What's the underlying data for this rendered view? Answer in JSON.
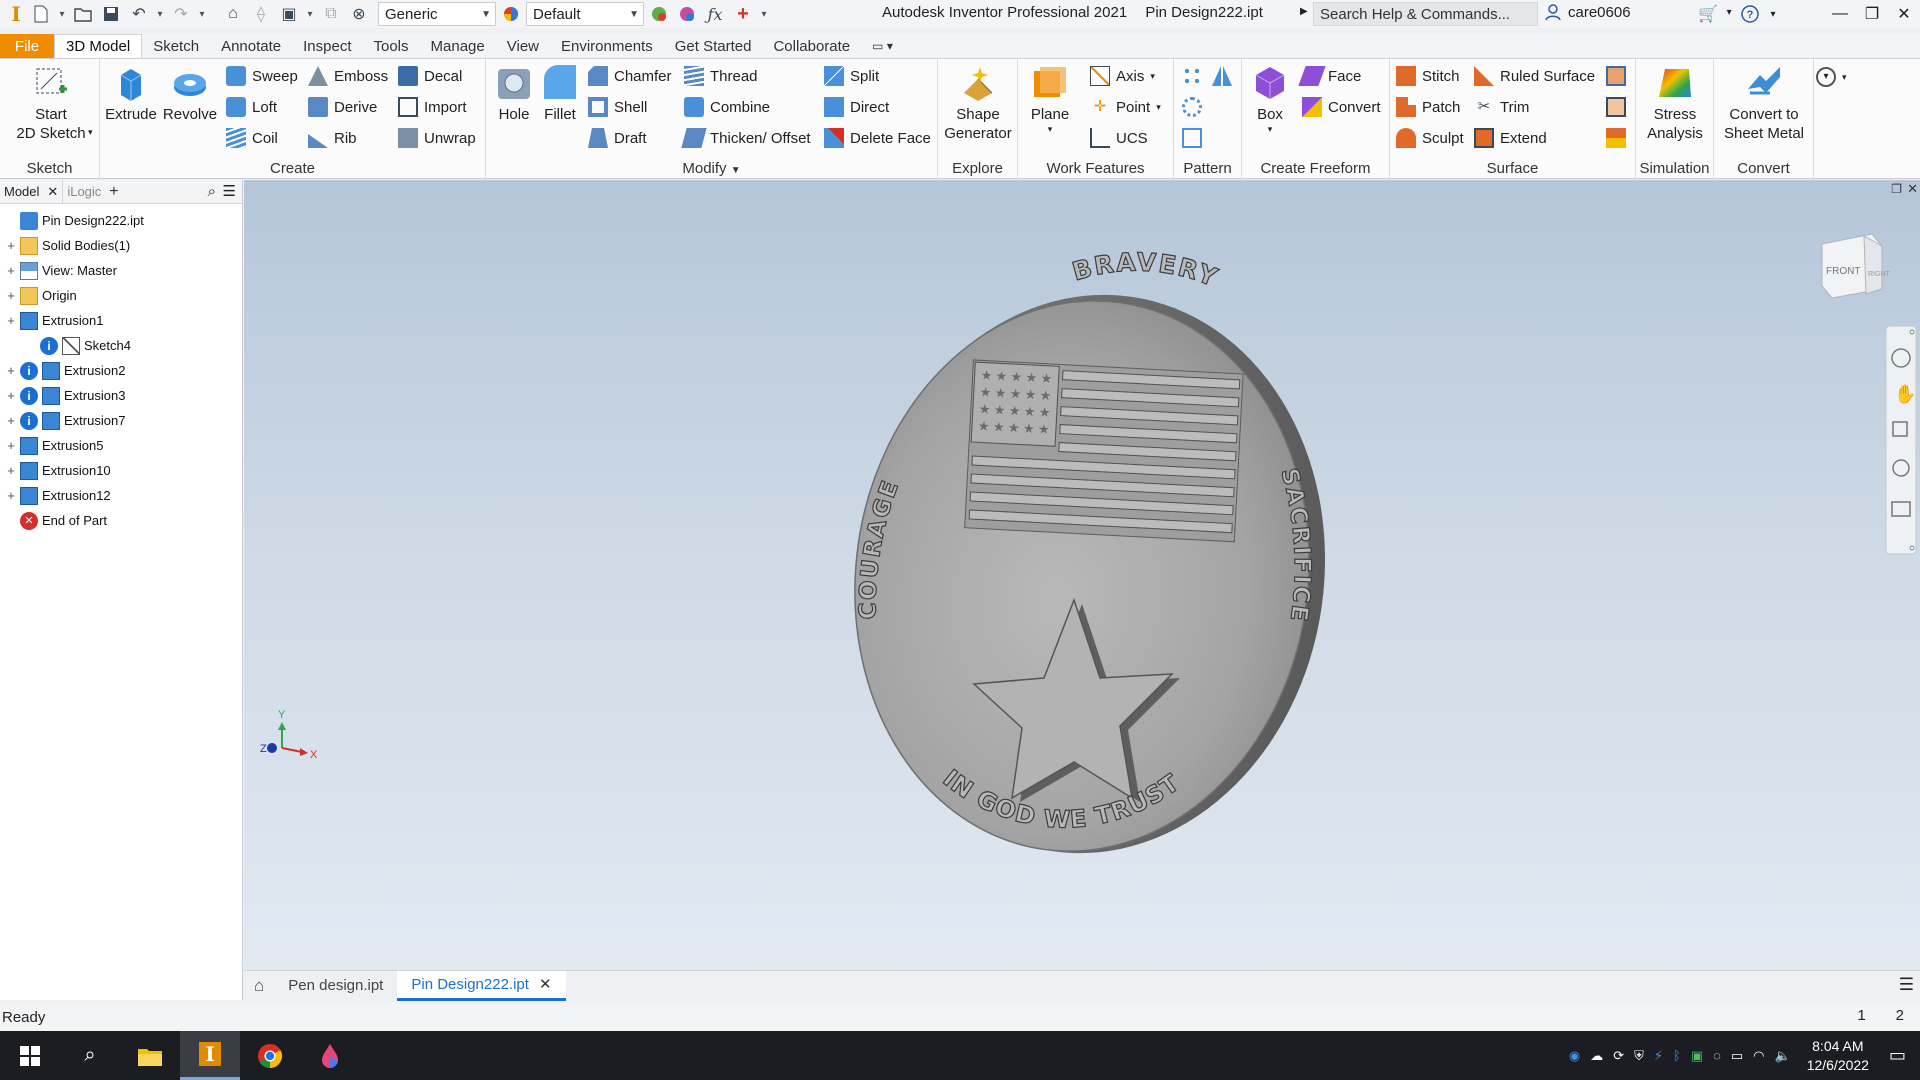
{
  "window": {
    "app_name": "Autodesk Inventor Professional 2021",
    "document": "Pin Design222.ipt",
    "search_placeholder": "Search Help & Commands...",
    "user": "care0606",
    "material_combo": "Generic",
    "appearance_combo": "Default"
  },
  "ribbon_tabs": [
    {
      "label": "File"
    },
    {
      "label": "3D Model"
    },
    {
      "label": "Sketch"
    },
    {
      "label": "Annotate"
    },
    {
      "label": "Inspect"
    },
    {
      "label": "Tools"
    },
    {
      "label": "Manage"
    },
    {
      "label": "View"
    },
    {
      "label": "Environments"
    },
    {
      "label": "Get Started"
    },
    {
      "label": "Collaborate"
    }
  ],
  "ribbon": {
    "sketch_panel": {
      "label": "Sketch",
      "start_sketch": "Start\n2D Sketch"
    },
    "create_panel": {
      "label": "Create",
      "extrude": "Extrude",
      "revolve": "Revolve",
      "sweep": "Sweep",
      "loft": "Loft",
      "coil": "Coil",
      "emboss": "Emboss",
      "derive": "Derive",
      "rib": "Rib",
      "decal": "Decal",
      "import": "Import",
      "unwrap": "Unwrap"
    },
    "modify_panel": {
      "label": "Modify",
      "hole": "Hole",
      "fillet": "Fillet",
      "chamfer": "Chamfer",
      "shell": "Shell",
      "draft": "Draft",
      "thread": "Thread",
      "combine": "Combine",
      "thicken": "Thicken/ Offset",
      "split": "Split",
      "direct": "Direct",
      "delete_face": "Delete Face"
    },
    "explore_panel": {
      "label": "Explore",
      "shape_generator": "Shape\nGenerator"
    },
    "work_features_panel": {
      "label": "Work Features",
      "plane": "Plane",
      "axis": "Axis",
      "point": "Point",
      "ucs": "UCS"
    },
    "pattern_panel": {
      "label": "Pattern"
    },
    "freeform_panel": {
      "label": "Create Freeform",
      "box": "Box",
      "face": "Face",
      "convert": "Convert"
    },
    "surface_panel": {
      "label": "Surface",
      "stitch": "Stitch",
      "patch": "Patch",
      "sculpt": "Sculpt",
      "ruled_surface": "Ruled Surface",
      "trim": "Trim",
      "extend": "Extend"
    },
    "simulation_panel": {
      "label": "Simulation",
      "stress_analysis": "Stress\nAnalysis"
    },
    "convert_panel": {
      "label": "Convert",
      "convert_sheet_metal": "Convert to\nSheet Metal"
    }
  },
  "browser": {
    "tabs": [
      {
        "label": "Model"
      },
      {
        "label": "iLogic"
      }
    ],
    "tree": [
      {
        "label": "Pin Design222.ipt",
        "icon": "part-icon",
        "expand": "",
        "info": false,
        "indent": 0
      },
      {
        "label": "Solid Bodies(1)",
        "icon": "folder-icon",
        "expand": "+",
        "info": false,
        "indent": 0
      },
      {
        "label": "View: Master",
        "icon": "view-icon",
        "expand": "+",
        "info": false,
        "indent": 0
      },
      {
        "label": "Origin",
        "icon": "folder-icon",
        "expand": "+",
        "info": false,
        "indent": 0
      },
      {
        "label": "Extrusion1",
        "icon": "extrusion-icon",
        "expand": "+",
        "info": false,
        "indent": 0
      },
      {
        "label": "Sketch4",
        "icon": "sketch-icon",
        "expand": "",
        "info": true,
        "indent": 1
      },
      {
        "label": "Extrusion2",
        "icon": "extrusion-icon",
        "expand": "+",
        "info": true,
        "indent": 0
      },
      {
        "label": "Extrusion3",
        "icon": "extrusion-icon",
        "expand": "+",
        "info": true,
        "indent": 0
      },
      {
        "label": "Extrusion7",
        "icon": "extrusion-icon",
        "expand": "+",
        "info": true,
        "indent": 0
      },
      {
        "label": "Extrusion5",
        "icon": "extrusion-icon",
        "expand": "+",
        "info": false,
        "indent": 0
      },
      {
        "label": "Extrusion10",
        "icon": "extrusion-icon",
        "expand": "+",
        "info": false,
        "indent": 0
      },
      {
        "label": "Extrusion12",
        "icon": "extrusion-icon",
        "expand": "+",
        "info": false,
        "indent": 0
      },
      {
        "label": "End of Part",
        "icon": "end-of-part-icon",
        "expand": "",
        "info": false,
        "indent": 0
      }
    ]
  },
  "coin": {
    "top": "BRAVERY",
    "left": "COURAGE",
    "right": "SACRIFICE",
    "bottom": "IN GOD WE TRUST"
  },
  "viewcube": {
    "front": "FRONT",
    "right": "RIGHT"
  },
  "document_tabs": [
    {
      "label": "Pen design.ipt",
      "active": false
    },
    {
      "label": "Pin Design222.ipt",
      "active": true
    }
  ],
  "status": {
    "text": "Ready",
    "num1": "1",
    "num2": "2"
  },
  "taskbar": {
    "time": "8:04 AM",
    "date": "12/6/2022"
  },
  "colors": {
    "file_tab": "#f08c00",
    "accent": "#1a6fd1",
    "coin": "#a7a7a7"
  }
}
